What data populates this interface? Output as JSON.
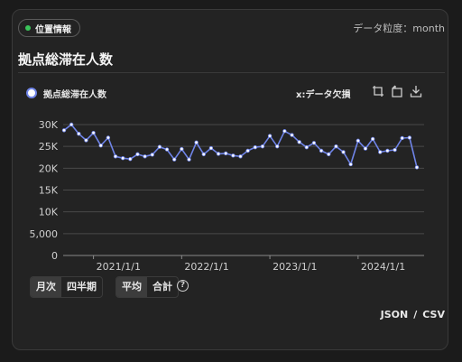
{
  "badge": {
    "label": "位置情報"
  },
  "granularity": "データ粒度：month",
  "title": "拠点総滞在人数",
  "legend": {
    "series_label": "拠点総滞在人数"
  },
  "missing_label": "x:データ欠損",
  "toolbar": {
    "icons": [
      "zoom-select-icon",
      "zoom-reset-icon",
      "download-icon"
    ]
  },
  "controls": {
    "period": [
      "月次",
      "四半期"
    ],
    "period_selected": 0,
    "agg": [
      "平均",
      "合計"
    ],
    "agg_selected": 0,
    "help": "?"
  },
  "export": {
    "json": "JSON",
    "sep": "/",
    "csv": "CSV"
  },
  "colors": {
    "series": "#6f84e8",
    "grid": "#4a4a4a"
  },
  "chart_data": {
    "type": "line",
    "series": [
      {
        "name": "拠点総滞在人数",
        "values": [
          28700,
          30000,
          27900,
          26400,
          28100,
          25200,
          27000,
          22700,
          22300,
          22100,
          23200,
          22700,
          23100,
          24900,
          24300,
          22000,
          24400,
          22000,
          25900,
          23200,
          24600,
          23300,
          23400,
          22900,
          22700,
          24000,
          24800,
          25000,
          27400,
          25000,
          28500,
          27600,
          26000,
          24800,
          25800,
          24000,
          23200,
          25000,
          23700,
          20900,
          26300,
          24500,
          26700,
          23700,
          24000,
          24200,
          26900,
          27000,
          20200
        ]
      }
    ],
    "x_start": "2020-09",
    "x_ticks": [
      "2021/1/1",
      "2022/1/1",
      "2023/1/1",
      "2024/1/1"
    ],
    "y_ticks": [
      "0",
      "5,000",
      "10K",
      "15K",
      "20K",
      "25K",
      "30K"
    ],
    "ylim": [
      0,
      30000
    ],
    "grid": true
  }
}
